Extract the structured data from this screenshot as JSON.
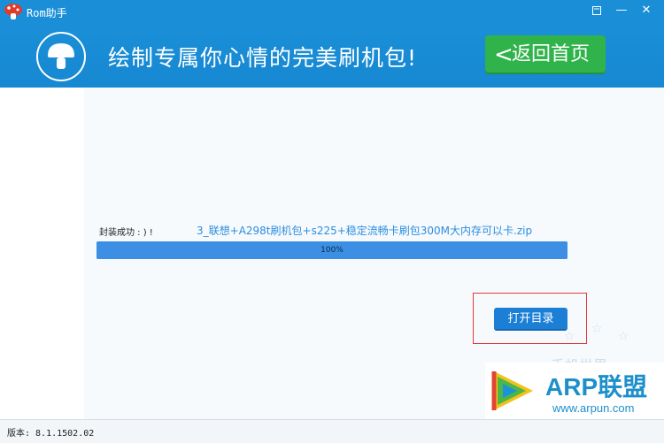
{
  "window": {
    "title": "Rom助手",
    "controls": {
      "restore_icon": "restore-icon",
      "minimize": "—",
      "close": "✕"
    }
  },
  "banner": {
    "slogan": "绘制专属你心情的完美刷机包!",
    "back_button": {
      "chevron": "<",
      "label": "返回首页"
    }
  },
  "progress": {
    "status_label": "封装成功 : ) !",
    "filename": "3_联想+A298t刷机包+s225+稳定流畅卡刷包300M大内存可以卡.zip",
    "percent": 100,
    "percent_label": "100%"
  },
  "actions": {
    "open_dir_label": "打开目录"
  },
  "watermark": {
    "text": "手机世界"
  },
  "arp": {
    "name": "ARP联盟",
    "url": "www.arpun.com"
  },
  "statusbar": {
    "version": "版本: 8.1.1502.02"
  },
  "colors": {
    "titlebar": "#1a8fd8",
    "back_button": "#2fb34a",
    "progress": "#3d8fe4",
    "primary_button": "#1b7fd6",
    "highlight": "#e03a3a"
  }
}
